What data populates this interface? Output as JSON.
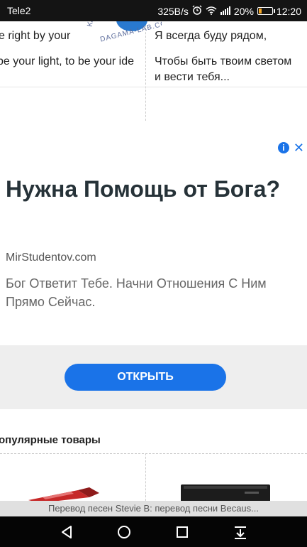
{
  "status_bar": {
    "carrier": "Tele2",
    "speed": "325B/s",
    "battery": "20%",
    "battery_level": 0.2,
    "time": "12:20",
    "icons": [
      "alarm-icon",
      "wifi-icon",
      "signal-icon",
      "battery-icon"
    ]
  },
  "lyrics": {
    "left": {
      "top_line": "e right by your",
      "main_line": "be your light, to be your ide"
    },
    "right": {
      "top_line": "Я всегда буду рядом,",
      "main_line": "Чтобы быть твоим светом и вести тебя..."
    },
    "watermark": {
      "site": "DAGAMA-LAB.COM",
      "side": "Ka"
    }
  },
  "ad": {
    "title": "Нужна Помощь от Бога?",
    "domain": "MirStudentov.com",
    "description": "Бог Ответит Тебе. Начни Отношения С Ним Прямо Сейчас.",
    "button": "ОТКРЫТЬ",
    "accent": "#1a73e8"
  },
  "popular": {
    "title": "опулярные товары"
  },
  "bottom_bar": {
    "text": "Перевод песен Stevie B: перевод песни Becaus..."
  },
  "navbar": {
    "icons": [
      "back-icon",
      "home-icon",
      "recents-icon",
      "notifications-icon"
    ]
  }
}
